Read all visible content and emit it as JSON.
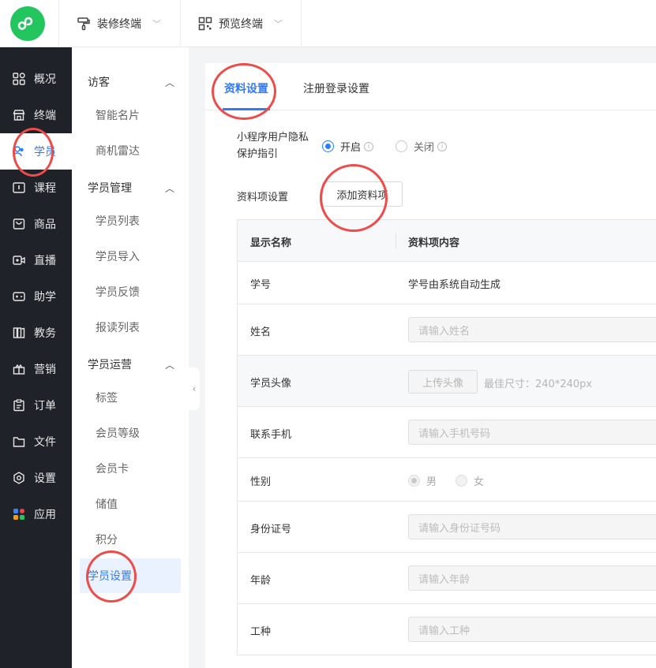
{
  "topbar": {
    "decorate_label": "装修终端",
    "preview_label": "预览终端"
  },
  "sidebar": {
    "items": [
      {
        "label": "概况",
        "icon": "dashboard-icon"
      },
      {
        "label": "终端",
        "icon": "store-icon"
      },
      {
        "label": "学员",
        "icon": "users-icon"
      },
      {
        "label": "课程",
        "icon": "course-icon"
      },
      {
        "label": "商品",
        "icon": "bag-icon"
      },
      {
        "label": "直播",
        "icon": "live-icon"
      },
      {
        "label": "助学",
        "icon": "gamepad-icon"
      },
      {
        "label": "教务",
        "icon": "books-icon"
      },
      {
        "label": "营销",
        "icon": "gift-icon"
      },
      {
        "label": "订单",
        "icon": "clipboard-icon"
      },
      {
        "label": "文件",
        "icon": "folder-icon"
      },
      {
        "label": "设置",
        "icon": "gear-icon"
      },
      {
        "label": "应用",
        "icon": "apps-icon"
      }
    ]
  },
  "submenu": {
    "groups": [
      {
        "title": "访客",
        "items": [
          "智能名片",
          "商机雷达"
        ]
      },
      {
        "title": "学员管理",
        "items": [
          "学员列表",
          "学员导入",
          "学员反馈",
          "报读列表"
        ]
      },
      {
        "title": "学员运营",
        "items": [
          "标签",
          "会员等级",
          "会员卡",
          "储值",
          "积分",
          "学员设置"
        ]
      }
    ]
  },
  "tabs": [
    "资料设置",
    "注册登录设置"
  ],
  "privacy": {
    "label": "小程序用户隐私保护指引",
    "on_label": "开启",
    "off_label": "关闭"
  },
  "items_section": {
    "label": "资料项设置",
    "add_button": "添加资料项"
  },
  "table": {
    "headers": [
      "显示名称",
      "资料项内容"
    ],
    "rows": [
      {
        "name": "学号",
        "text": "学号由系统自动生成"
      },
      {
        "name": "姓名",
        "placeholder": "请输入姓名"
      },
      {
        "name": "学员头像",
        "upload": "上传头像",
        "hint": "最佳尺寸：240*240px"
      },
      {
        "name": "联系手机",
        "placeholder": "请输入手机号码"
      },
      {
        "name": "性别",
        "male": "男",
        "female": "女"
      },
      {
        "name": "身份证号",
        "placeholder": "请输入身份证号码"
      },
      {
        "name": "年龄",
        "placeholder": "请输入年龄"
      },
      {
        "name": "工种",
        "placeholder": "请输入工种"
      }
    ]
  },
  "colors": {
    "accent": "#2f7cf6",
    "sidebar_bg": "#1f2329",
    "logo": "#22c55e",
    "annotation": "#ee4b4b"
  }
}
